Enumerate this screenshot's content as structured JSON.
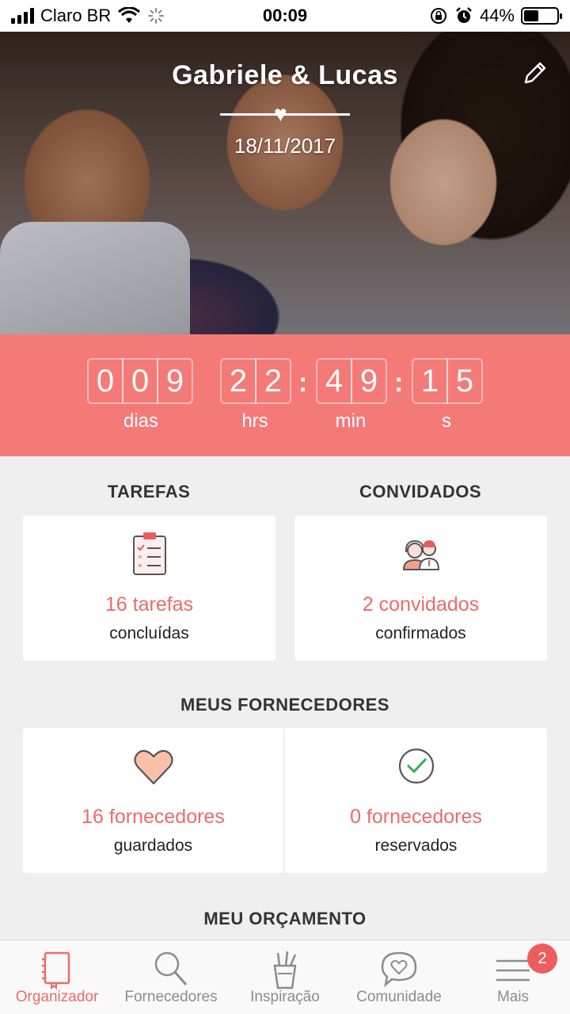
{
  "status_bar": {
    "carrier": "Claro BR",
    "time": "00:09",
    "battery": "44%",
    "battery_level": 0.44
  },
  "hero": {
    "couple_name": "Gabriele & Lucas",
    "wedding_date": "18/11/2017"
  },
  "countdown": {
    "days": [
      "0",
      "0",
      "9"
    ],
    "hours": [
      "2",
      "2"
    ],
    "minutes": [
      "4",
      "9"
    ],
    "seconds": [
      "1",
      "5"
    ],
    "days_label": "dias",
    "hours_label": "hrs",
    "minutes_label": "min",
    "seconds_label": "s",
    "separator": ":"
  },
  "tasks": {
    "title": "TAREFAS",
    "count": "16 tarefas",
    "sub": "concluídas"
  },
  "guests": {
    "title": "CONVIDADOS",
    "count": "2 convidados",
    "sub": "confirmados"
  },
  "vendors": {
    "title": "MEUS FORNECEDORES",
    "saved_count": "16 fornecedores",
    "saved_sub": "guardados",
    "booked_count": "0 fornecedores",
    "booked_sub": "reservados"
  },
  "budget": {
    "title": "MEU ORÇAMENTO"
  },
  "tabbar": {
    "items": [
      {
        "label": "Organizador",
        "icon": "notebook-icon",
        "active": true
      },
      {
        "label": "Fornecedores",
        "icon": "search-icon",
        "active": false
      },
      {
        "label": "Inspiração",
        "icon": "pencil-cup-icon",
        "active": false
      },
      {
        "label": "Comunidade",
        "icon": "heart-chat-icon",
        "active": false
      },
      {
        "label": "Mais",
        "icon": "menu-icon",
        "active": false,
        "badge": "2"
      }
    ]
  },
  "colors": {
    "accent": "#f47a78",
    "text_accent": "#ee6a6a",
    "background": "#efefef"
  }
}
